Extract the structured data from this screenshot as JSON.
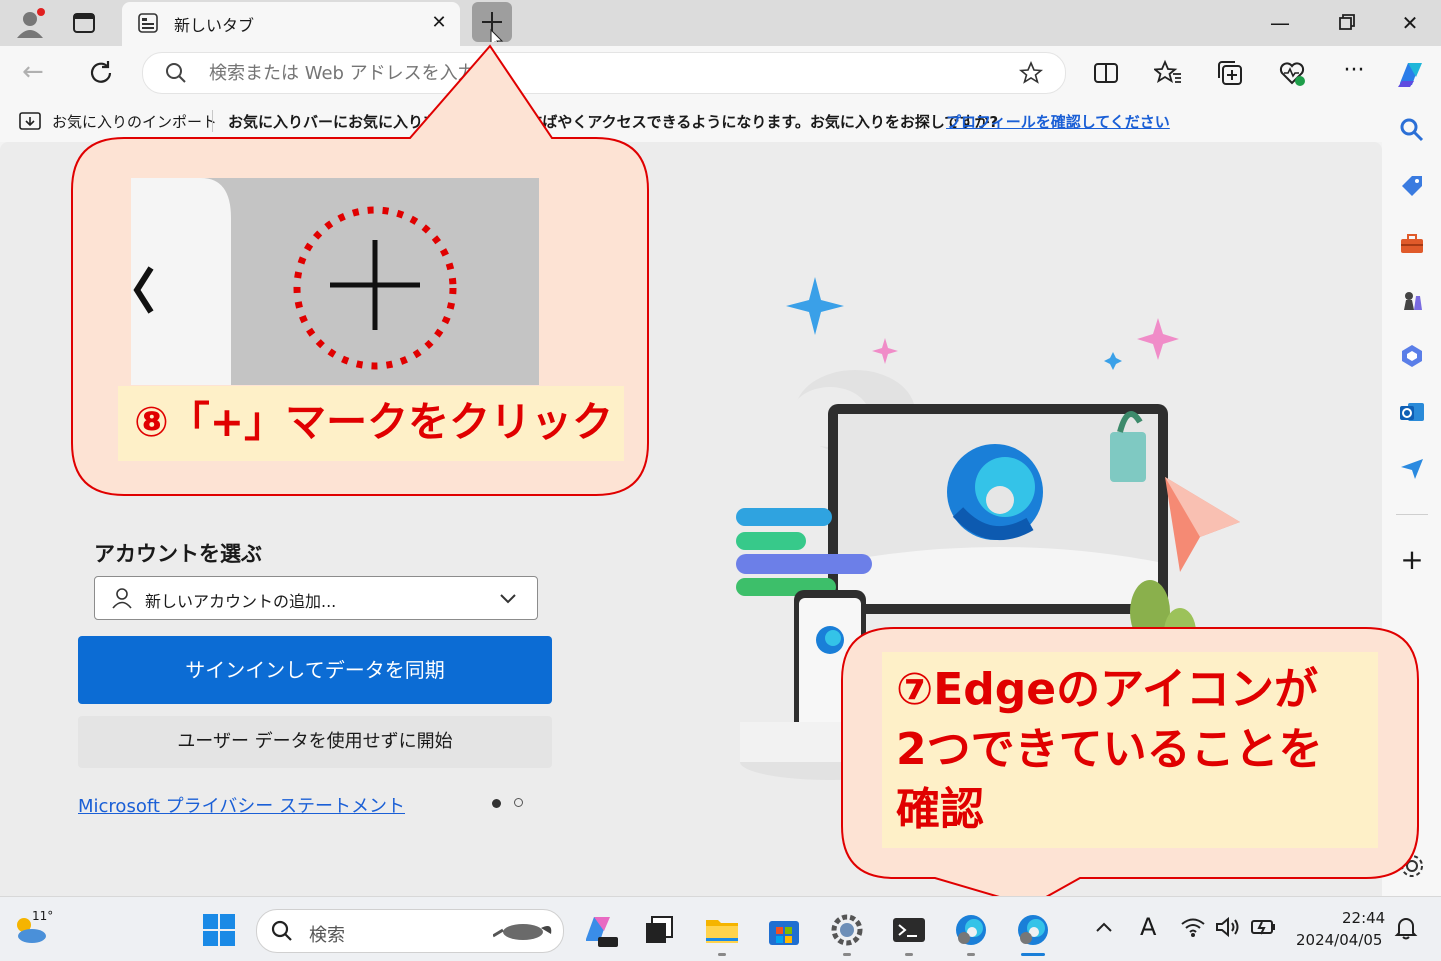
{
  "browser": {
    "tab_title": "新しいタブ",
    "address_placeholder": "検索または Web アドレスを入力"
  },
  "favorites_bar": {
    "import_label": "お気に入りのインポート",
    "message": "お気に入りバーにお気に入りを追加すると、すばやくアクセスできるようになります。お気に入りをお探しですか?",
    "link": "プロフィールを確認してください"
  },
  "account": {
    "title": "アカウントを選ぶ",
    "select_value": "新しいアカウントの追加...",
    "signin_button": "サインインしてデータを同期",
    "no_user_button": "ユーザー データを使用せずに開始",
    "privacy_link": "Microsoft プライバシー ステートメント"
  },
  "callouts": {
    "step8": "⑧「+」マークをクリック",
    "step7_lines": [
      "⑦Edgeのアイコンが",
      "2つできていることを",
      "確認"
    ]
  },
  "taskbar": {
    "weather_temp": "11°",
    "search_placeholder": "検索",
    "time": "22:44",
    "date": "2024/04/05",
    "ime_label": "A"
  },
  "colors": {
    "accent": "#0c6cd4",
    "callout_fill": "#fde3d4",
    "callout_border": "#e00000",
    "callout_text": "#e00000",
    "callout_label_bg": "#fef0c8"
  }
}
